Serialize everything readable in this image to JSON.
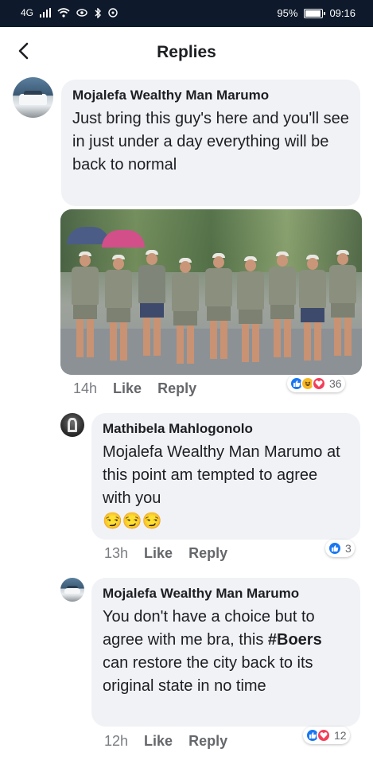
{
  "status_bar": {
    "network": "4G",
    "battery_percent": "95%",
    "battery_level": 0.95,
    "time": "09:16"
  },
  "header": {
    "title": "Replies",
    "back_icon": "chevron-left-icon"
  },
  "comments": [
    {
      "author": "Mojalefa Wealthy Man Marumo",
      "text": "Just bring this guy's here and you'll see in just under a day everything will be back to normal",
      "time": "14h",
      "like_label": "Like",
      "reply_label": "Reply",
      "reaction_count": "36",
      "reactions": [
        "like",
        "haha",
        "love"
      ]
    },
    {
      "author": "Mathibela Mahlogonolo",
      "text": "Mojalefa Wealthy Man Marumo  at this point am tempted to agree with you",
      "emojis": "😏😏😏",
      "time": "13h",
      "like_label": "Like",
      "reply_label": "Reply",
      "reaction_count": "3",
      "reactions": [
        "like"
      ]
    },
    {
      "author": "Mojalefa Wealthy Man Marumo",
      "text_before": "You don't have a choice but to agree with me bra, this ",
      "hashtag": "#Boers",
      "text_after": " can restore the city back to its original state in no time",
      "time": "12h",
      "like_label": "Like",
      "reply_label": "Reply",
      "reaction_count": "12",
      "reactions": [
        "like",
        "love"
      ]
    }
  ],
  "colors": {
    "status_bar": "#0e1a2b",
    "bubble": "#f0f2f5",
    "like_blue": "#1877f2",
    "love_red": "#f33e58",
    "haha_yellow": "#f7b928",
    "meta_grey": "#65676b"
  }
}
